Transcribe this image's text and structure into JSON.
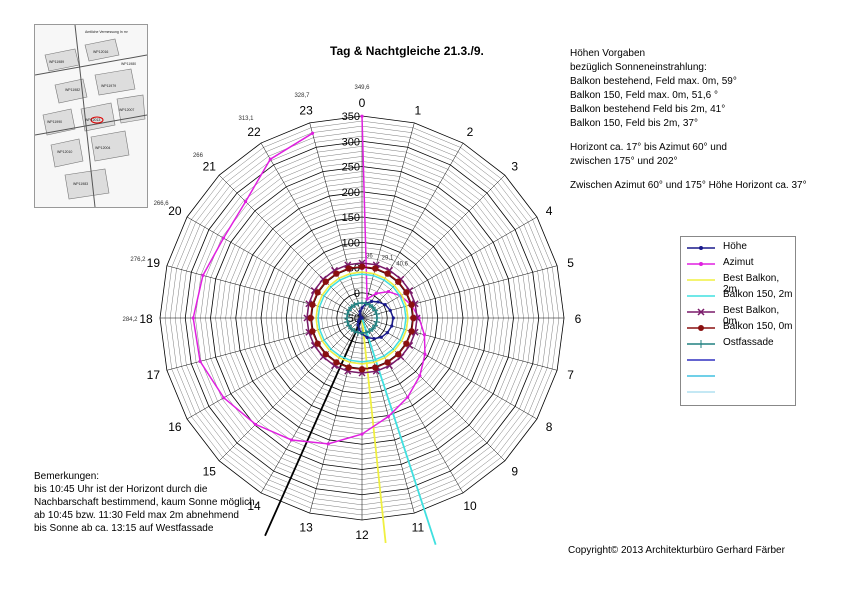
{
  "title": "Tag & Nachtgleiche 21.3./9.",
  "heights": {
    "lines1": [
      "Höhen Vorgaben",
      "bezüglich Sonneneinstrahlung:",
      "Balkon bestehend, Feld max. 0m, 59°",
      "Balkon 150, Feld max. 0m, 51,6 °",
      "Balkon bestehend Feld bis 2m, 41°",
      "Balkon 150, Feld bis 2m, 37°"
    ],
    "lines2": [
      "Horizont ca. 17° bis Azimut 60° und",
      "zwischen 175° und 202°"
    ],
    "lines3": [
      "Zwischen Azimut 60° und 175° Höhe Horizont ca. 37°"
    ]
  },
  "remarks": [
    "Bemerkungen:",
    "bis 10:45 Uhr ist der Horizont durch die",
    "Nachbarschaft bestimmend, kaum Sonne möglich.",
    "ab 10:45 bzw. 11:30 Feld max 2m abnehmend",
    "bis Sonne ab ca. 13:15 auf Westfassade"
  ],
  "copyright": "Copyright© 2013 Architekturbüro Gerhard Färber",
  "legend": [
    {
      "label": "Höhe",
      "color": "#1a1a8c",
      "marker": "dot"
    },
    {
      "label": "Azimut",
      "color": "#e020e0",
      "marker": "dot"
    },
    {
      "label": "Best Balkon, 2m",
      "color": "#f0f040",
      "marker": "none"
    },
    {
      "label": "Balkon 150, 2m",
      "color": "#40e0e0",
      "marker": "none"
    },
    {
      "label": "Best Balkon, 0m",
      "color": "#7a1a6a",
      "marker": "x"
    },
    {
      "label": "Balkon 150, 0m",
      "color": "#8a1010",
      "marker": "circle"
    },
    {
      "label": "Ostfassade",
      "color": "#208080",
      "marker": "plus"
    },
    {
      "label": "",
      "color": "#3030c0",
      "marker": "dash"
    },
    {
      "label": "",
      "color": "#40c0e0",
      "marker": "dash"
    },
    {
      "label": "",
      "color": "#b0e0f0",
      "marker": "dash"
    }
  ],
  "map": {
    "labels": [
      "Amtliche Vermessung In m³",
      "WP12016",
      "WP11989",
      "WP11982",
      "WP11979",
      "WP11990",
      "WP12013",
      "WP12007",
      "WP12010",
      "WP12004",
      "WP11983",
      "WP11980"
    ]
  },
  "chart_data": {
    "type": "radar",
    "categories": [
      "0",
      "1",
      "2",
      "3",
      "4",
      "5",
      "6",
      "7",
      "8",
      "9",
      "10",
      "11",
      "12",
      "13",
      "14",
      "15",
      "16",
      "17",
      "18",
      "19",
      "20",
      "21",
      "22",
      "23"
    ],
    "r_ticks": [
      -50,
      0,
      50,
      100,
      150,
      200,
      250,
      300,
      350
    ],
    "rlim": [
      -50,
      350
    ],
    "spoke_labels": [
      "349,6",
      "",
      "",
      "",
      "",
      "",
      "",
      "",
      "",
      "",
      "",
      "",
      "",
      "",
      "",
      "",
      "",
      "",
      "284,2",
      "276,2",
      "266,6",
      "266",
      "313,1",
      "328,7"
    ],
    "inner_labels": [
      "36",
      "29,1",
      "40,6",
      "",
      "",
      "",
      "",
      "",
      "",
      "",
      "",
      "",
      "",
      "",
      "",
      "",
      "",
      "",
      "",
      "",
      "",
      "",
      "",
      ""
    ],
    "series": [
      {
        "name": "Azimut",
        "color": "#e020e0",
        "values": [
          349.6,
          -11,
          6,
          24,
          38,
          51,
          63,
          78,
          94,
          112,
          131,
          152,
          180,
          208,
          229,
          248,
          266,
          282,
          284.2,
          276.2,
          266.6,
          276,
          313.1,
          328.7
        ]
      },
      {
        "name": "Höhe",
        "color": "#1a1a8c",
        "values": [
          -30,
          -20,
          -12,
          -5,
          3,
          8,
          12,
          11,
          8,
          4,
          -3,
          -10,
          -19,
          -27,
          -34,
          -40,
          -44,
          -47,
          -49,
          -50,
          -50,
          -47,
          -42,
          -36
        ]
      },
      {
        "name": "Best Balkon, 2m",
        "color": "#f0f040",
        "values": [
          41,
          41,
          41,
          41,
          41,
          41,
          41,
          41,
          41,
          41,
          41,
          41,
          41,
          41,
          41,
          41,
          41,
          41,
          41,
          41,
          41,
          41,
          41,
          41
        ]
      },
      {
        "name": "Balkon 150, 2m",
        "color": "#40e0e0",
        "values": [
          37,
          37,
          37,
          37,
          37,
          37,
          37,
          37,
          37,
          37,
          37,
          37,
          37,
          37,
          37,
          37,
          37,
          37,
          37,
          37,
          37,
          37,
          37,
          37
        ]
      },
      {
        "name": "Best Balkon, 0m",
        "color": "#7a1a6a",
        "values": [
          59,
          59,
          59,
          59,
          59,
          59,
          59,
          59,
          59,
          59,
          59,
          59,
          59,
          59,
          59,
          59,
          59,
          59,
          59,
          59,
          59,
          59,
          59,
          59
        ]
      },
      {
        "name": "Balkon 150, 0m",
        "color": "#8a1010",
        "values": [
          51.6,
          51.6,
          51.6,
          51.6,
          51.6,
          51.6,
          51.6,
          51.6,
          51.6,
          51.6,
          51.6,
          51.6,
          51.6,
          51.6,
          51.6,
          51.6,
          51.6,
          51.6,
          51.6,
          51.6,
          51.6,
          51.6,
          51.6,
          51.6
        ]
      },
      {
        "name": "Ostfassade",
        "color": "#208080",
        "values": [
          -20,
          -20,
          -20,
          -20,
          -20,
          -20,
          -20,
          -20,
          -20,
          -20,
          -20,
          -20,
          -20,
          -20,
          -20,
          -20,
          -20,
          -20,
          -20,
          -20,
          -20,
          -20,
          -20,
          -20
        ]
      }
    ]
  }
}
